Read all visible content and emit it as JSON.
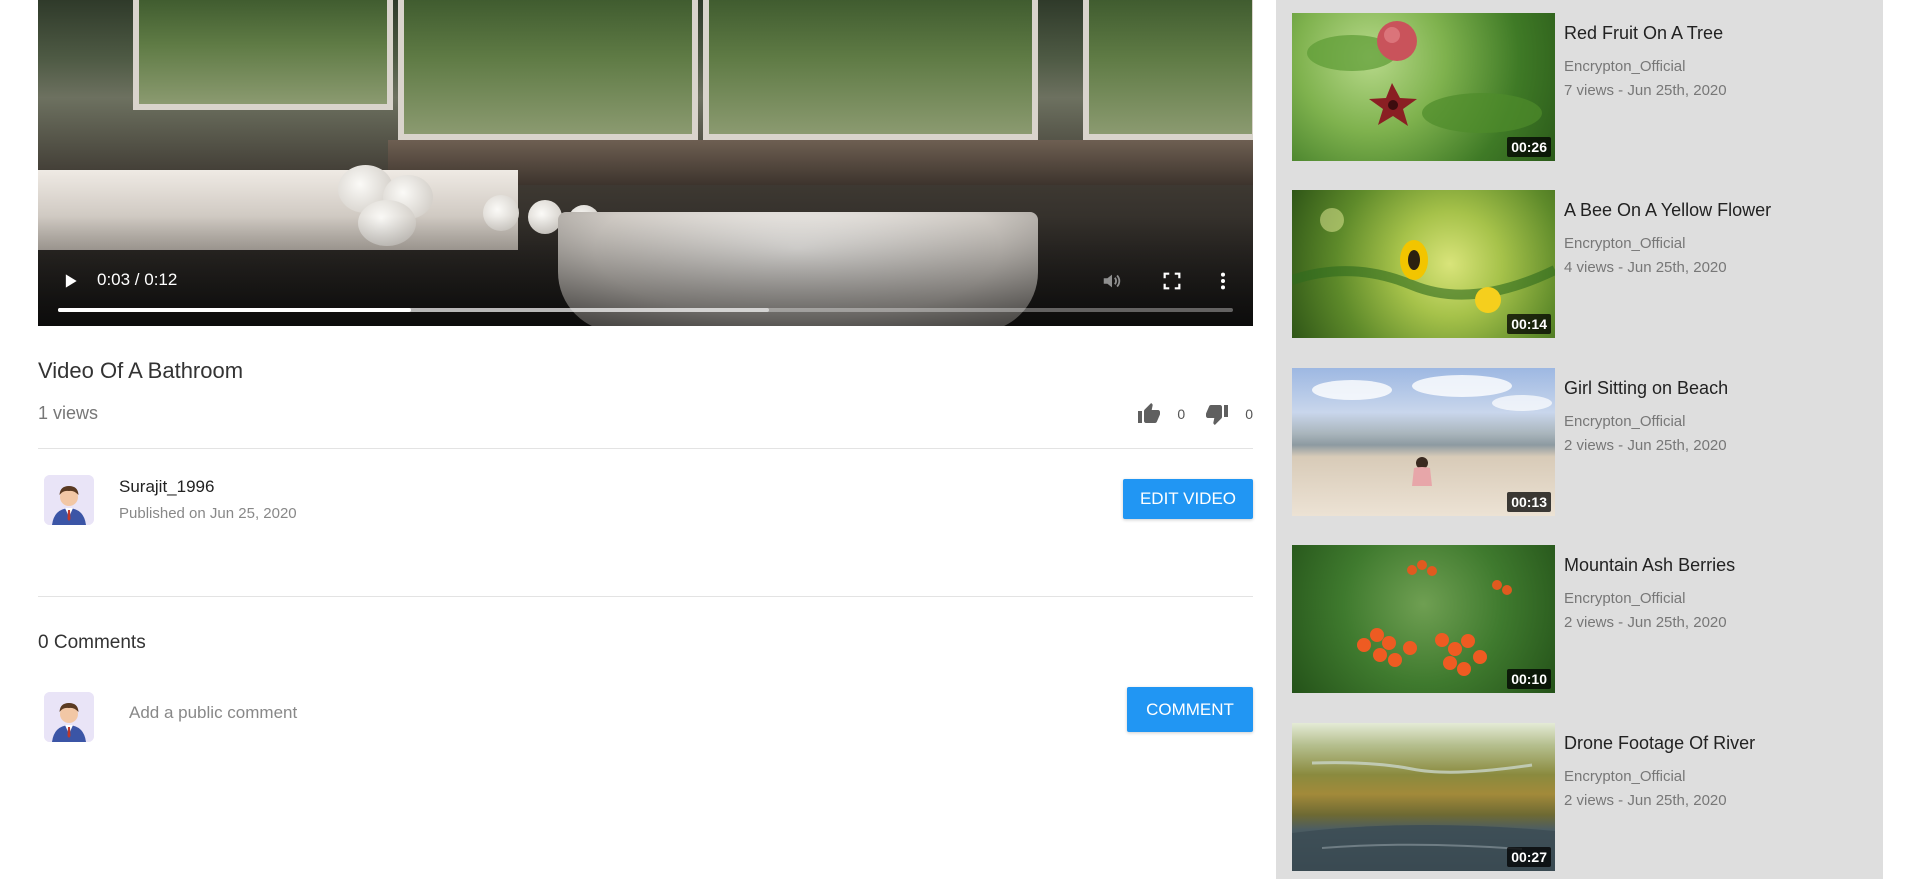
{
  "player": {
    "time_display": "0:03 / 0:12",
    "progress": {
      "played_fraction": 0.3,
      "buffered_fraction": 0.605
    },
    "icons": {
      "play": "play-icon",
      "volume": "volume-icon",
      "fullscreen": "fullscreen-icon",
      "more": "more-vert-icon"
    }
  },
  "video": {
    "title": "Video Of A Bathroom",
    "views": "1 views",
    "likes": "0",
    "dislikes": "0"
  },
  "channel": {
    "name": "Surajit_1996",
    "published": "Published on Jun 25, 2020",
    "edit_label": "EDIT VIDEO"
  },
  "comments": {
    "count_label": "0 Comments",
    "placeholder": "Add a public comment",
    "submit_label": "COMMENT"
  },
  "colors": {
    "accent": "#2196f3",
    "sidebar_bg": "#dedede"
  },
  "sidebar": {
    "items": [
      {
        "title": "Red Fruit On A Tree",
        "channel": "Encrypton_Official",
        "meta": "7 views - Jun 25th, 2020",
        "duration": "00:26"
      },
      {
        "title": "A Bee On A Yellow Flower",
        "channel": "Encrypton_Official",
        "meta": "4 views - Jun 25th, 2020",
        "duration": "00:14"
      },
      {
        "title": "Girl Sitting on Beach",
        "channel": "Encrypton_Official",
        "meta": "2 views - Jun 25th, 2020",
        "duration": "00:13"
      },
      {
        "title": "Mountain Ash Berries",
        "channel": "Encrypton_Official",
        "meta": "2 views - Jun 25th, 2020",
        "duration": "00:10"
      },
      {
        "title": "Drone Footage Of River",
        "channel": "Encrypton_Official",
        "meta": "2 views - Jun 25th, 2020",
        "duration": "00:27"
      }
    ]
  }
}
